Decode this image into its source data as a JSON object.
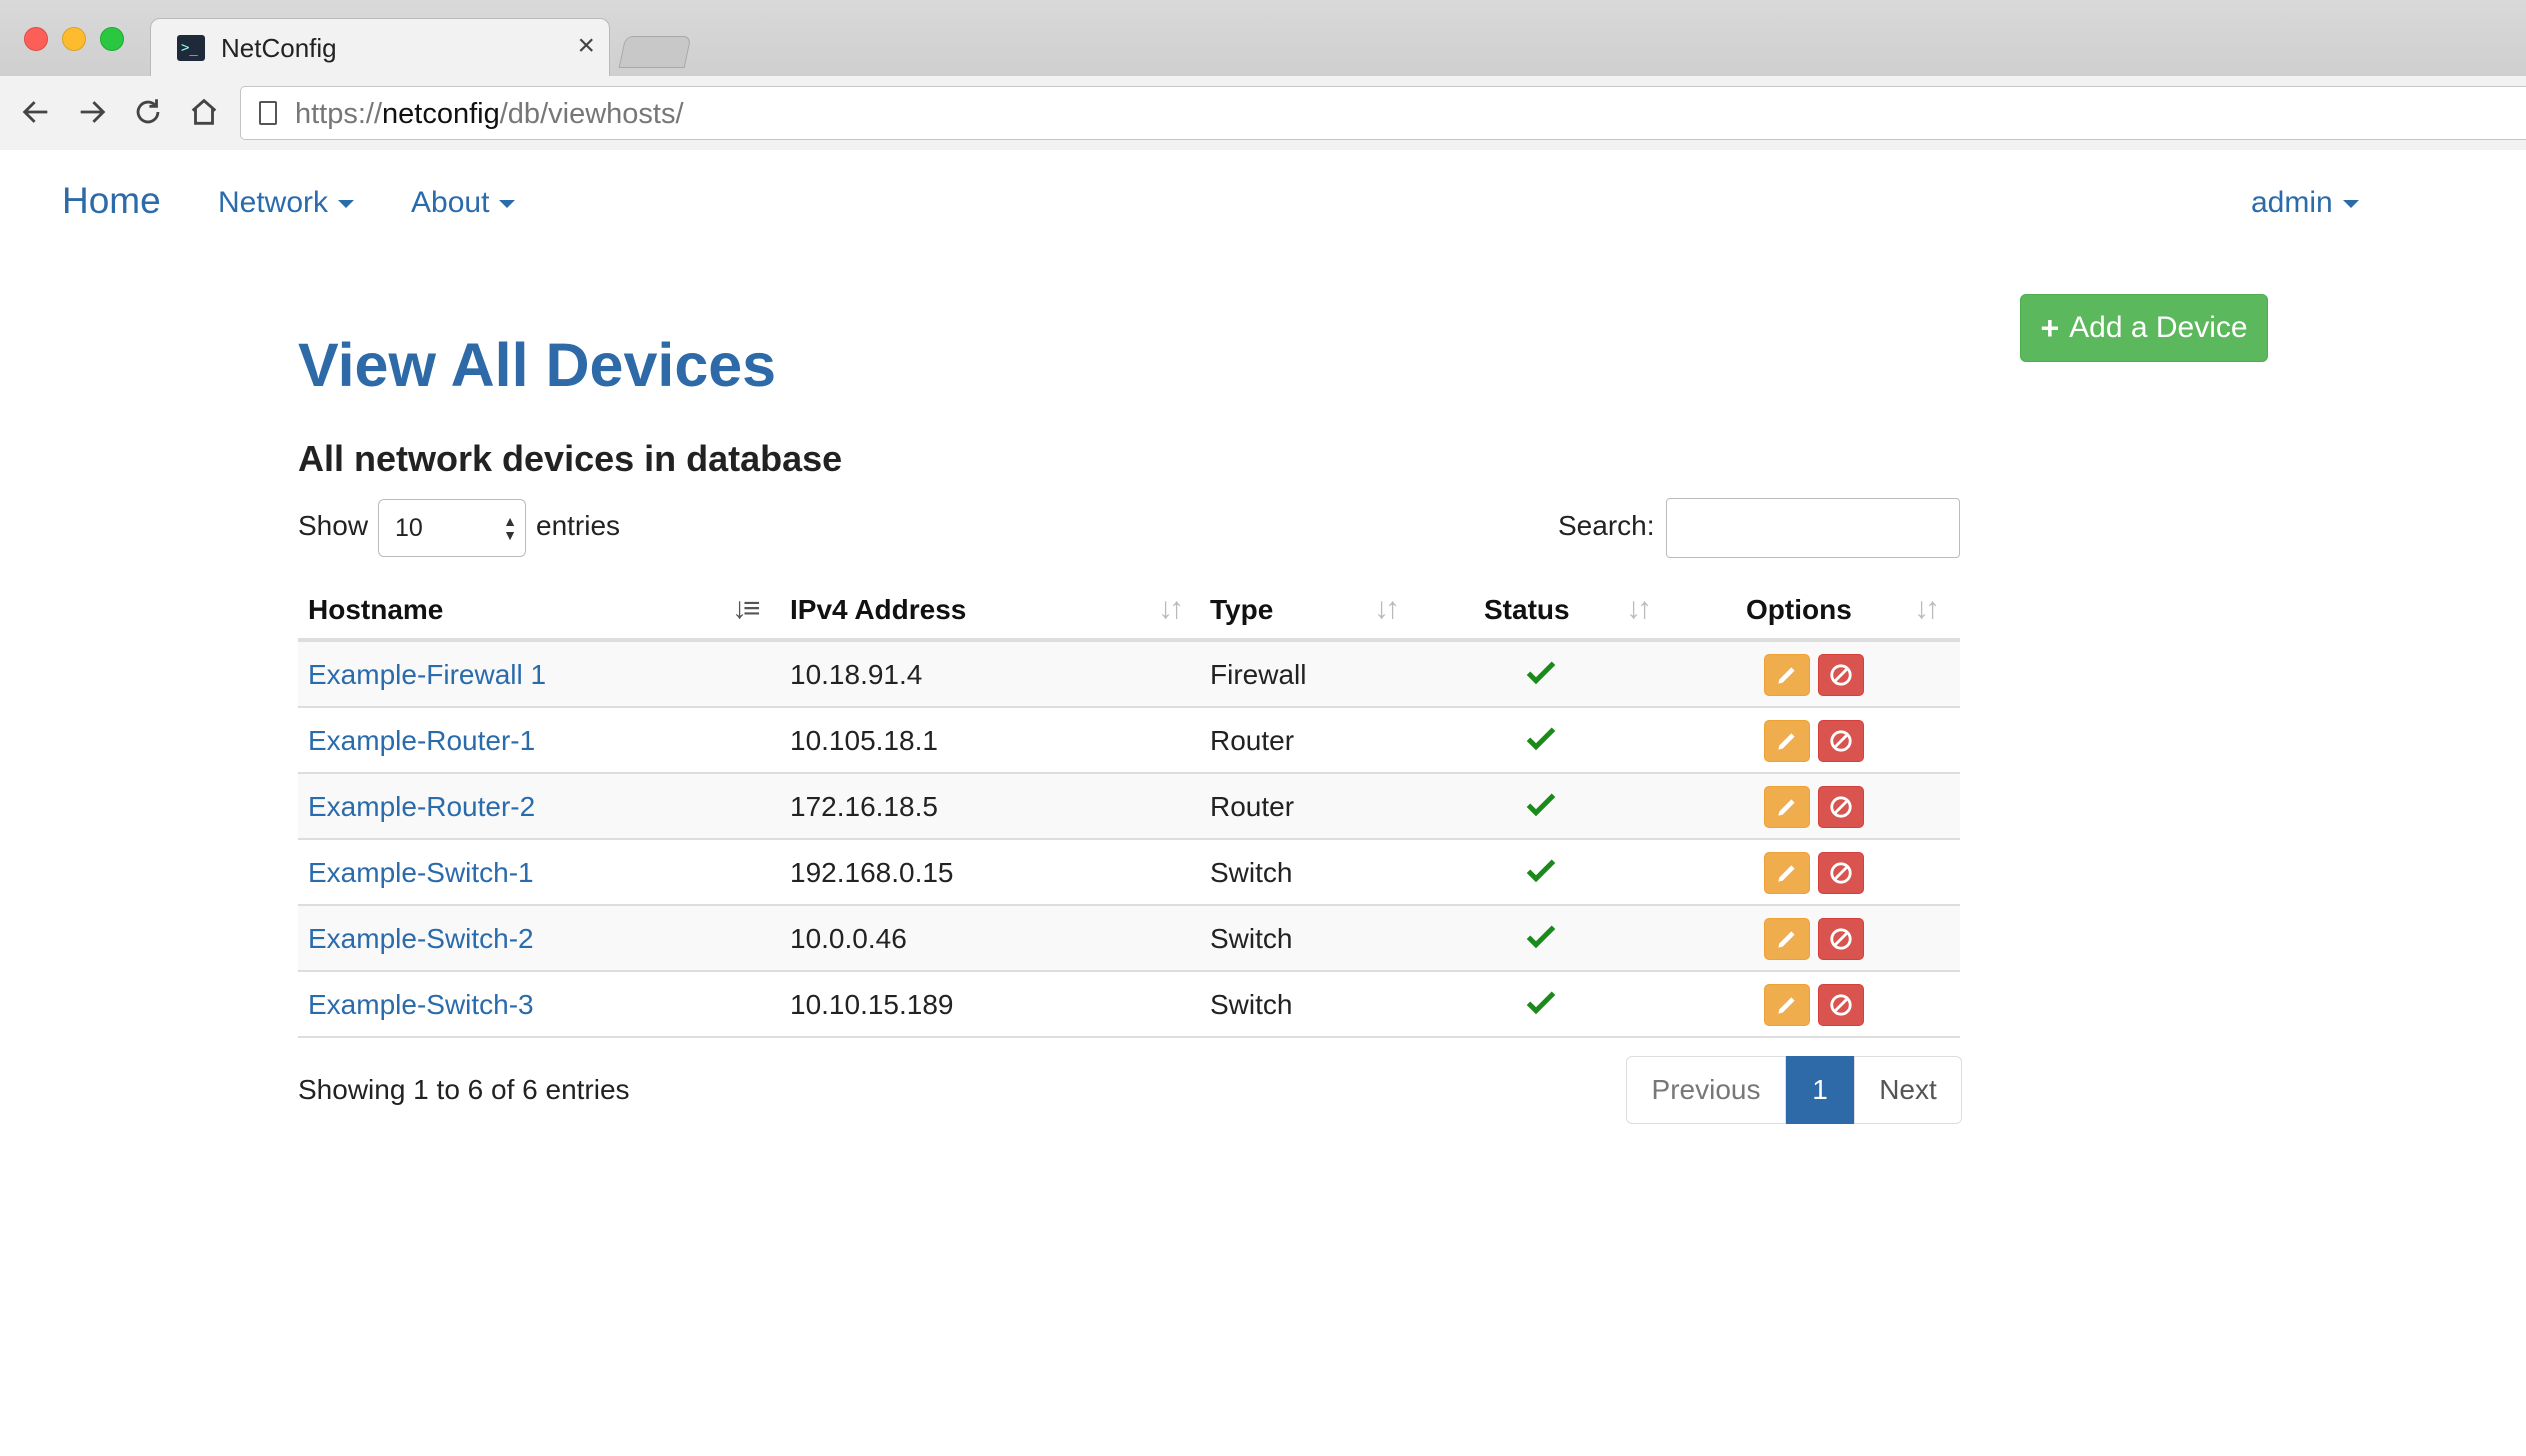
{
  "browser": {
    "tab_title": "NetConfig",
    "tab_close": "×",
    "favicon_glyph": ">_",
    "url_scheme": "https://",
    "url_host": "netconfig",
    "url_path": "/db/viewhosts/"
  },
  "navbar": {
    "home": "Home",
    "network": "Network",
    "about": "About",
    "user": "admin"
  },
  "page": {
    "title": "View All Devices",
    "subtitle": "All network devices in database",
    "add_button_icon": "+",
    "add_button_label": "Add a Device"
  },
  "controls": {
    "show_label": "Show",
    "entries_value": "10",
    "entries_label": "entries",
    "search_label": "Search:",
    "search_value": ""
  },
  "table": {
    "columns": [
      "Hostname",
      "IPv4 Address",
      "Type",
      "Status",
      "Options"
    ],
    "sorted_column": "Hostname",
    "rows": [
      {
        "hostname": "Example-Firewall 1",
        "ip": "10.18.91.4",
        "type": "Firewall",
        "status": "ok"
      },
      {
        "hostname": "Example-Router-1",
        "ip": "10.105.18.1",
        "type": "Router",
        "status": "ok"
      },
      {
        "hostname": "Example-Router-2",
        "ip": "172.16.18.5",
        "type": "Router",
        "status": "ok"
      },
      {
        "hostname": "Example-Switch-1",
        "ip": "192.168.0.15",
        "type": "Switch",
        "status": "ok"
      },
      {
        "hostname": "Example-Switch-2",
        "ip": "10.0.0.46",
        "type": "Switch",
        "status": "ok"
      },
      {
        "hostname": "Example-Switch-3",
        "ip": "10.10.15.189",
        "type": "Switch",
        "status": "ok"
      }
    ]
  },
  "footer": {
    "info": "Showing 1 to 6 of 6 entries",
    "prev": "Previous",
    "current_page": "1",
    "next": "Next"
  },
  "colors": {
    "link": "#2a6bab",
    "success": "#5cb85c",
    "warning": "#f0ad4e",
    "danger": "#d9534f",
    "check": "#1a8a1a"
  }
}
